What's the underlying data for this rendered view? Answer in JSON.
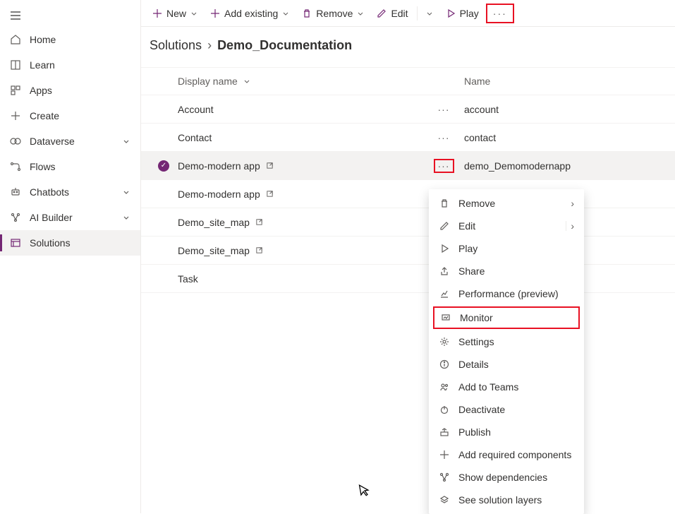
{
  "sidebar": {
    "items": [
      {
        "label": "Home"
      },
      {
        "label": "Learn"
      },
      {
        "label": "Apps"
      },
      {
        "label": "Create"
      },
      {
        "label": "Dataverse"
      },
      {
        "label": "Flows"
      },
      {
        "label": "Chatbots"
      },
      {
        "label": "AI Builder"
      },
      {
        "label": "Solutions"
      }
    ]
  },
  "toolbar": {
    "new": "New",
    "add_existing": "Add existing",
    "remove": "Remove",
    "edit": "Edit",
    "play": "Play"
  },
  "breadcrumb": {
    "root": "Solutions",
    "current": "Demo_Documentation"
  },
  "table": {
    "headers": {
      "display": "Display name",
      "name": "Name"
    },
    "rows": [
      {
        "display": "Account",
        "name": "account",
        "open": false,
        "selected": false,
        "show_more": true
      },
      {
        "display": "Contact",
        "name": "contact",
        "open": false,
        "selected": false,
        "show_more": true
      },
      {
        "display": "Demo-modern app",
        "name": "demo_Demomodernapp",
        "open": true,
        "selected": true,
        "show_more": true
      },
      {
        "display": "Demo-modern app",
        "name": "",
        "open": true,
        "selected": false,
        "show_more": false
      },
      {
        "display": "Demo_site_map",
        "name": "",
        "open": true,
        "selected": false,
        "show_more": false
      },
      {
        "display": "Demo_site_map",
        "name": "",
        "open": true,
        "selected": false,
        "show_more": false
      },
      {
        "display": "Task",
        "name": "",
        "open": false,
        "selected": false,
        "show_more": false
      }
    ]
  },
  "context_menu": {
    "items": [
      {
        "label": "Remove",
        "sub": true
      },
      {
        "label": "Edit",
        "sub": true,
        "split": true
      },
      {
        "label": "Play"
      },
      {
        "label": "Share"
      },
      {
        "label": "Performance (preview)"
      },
      {
        "label": "Monitor",
        "highlight": true
      },
      {
        "label": "Settings"
      },
      {
        "label": "Details"
      },
      {
        "label": "Add to Teams"
      },
      {
        "label": "Deactivate"
      },
      {
        "label": "Publish"
      },
      {
        "label": "Add required components"
      },
      {
        "label": "Show dependencies"
      },
      {
        "label": "See solution layers"
      }
    ]
  }
}
